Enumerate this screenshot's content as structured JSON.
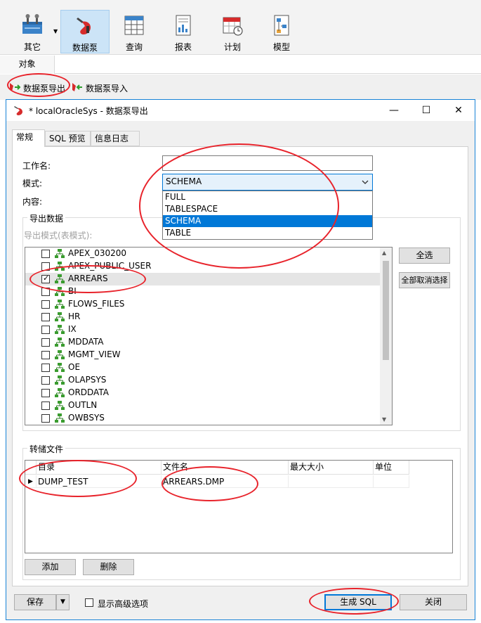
{
  "ribbon": {
    "items": [
      {
        "label": "其它"
      },
      {
        "label": "数据泵"
      },
      {
        "label": "查询"
      },
      {
        "label": "报表"
      },
      {
        "label": "计划"
      },
      {
        "label": "模型"
      }
    ]
  },
  "object_tab": {
    "label": "对象"
  },
  "toolbar2": {
    "export_label": "数据泵导出",
    "import_label": "数据泵导入"
  },
  "dialog": {
    "title": "* localOracleSys - 数据泵导出",
    "tabs": [
      {
        "label": "常规"
      },
      {
        "label": "SQL 预览"
      },
      {
        "label": "信息日志"
      }
    ],
    "job_name_label": "工作名:",
    "job_name_value": "",
    "mode_label": "模式:",
    "mode_value": "SCHEMA",
    "mode_options": [
      "FULL",
      "TABLESPACE",
      "SCHEMA",
      "TABLE"
    ],
    "content_label": "内容:",
    "export_group_title": "导出数据",
    "export_mode_label": "导出模式(表模式):",
    "schemas": [
      {
        "name": "APEX_030200",
        "checked": false
      },
      {
        "name": "APEX_PUBLIC_USER",
        "checked": false
      },
      {
        "name": "ARREARS",
        "checked": true
      },
      {
        "name": "BI",
        "checked": false
      },
      {
        "name": "FLOWS_FILES",
        "checked": false
      },
      {
        "name": "HR",
        "checked": false
      },
      {
        "name": "IX",
        "checked": false
      },
      {
        "name": "MDDATA",
        "checked": false
      },
      {
        "name": "MGMT_VIEW",
        "checked": false
      },
      {
        "name": "OE",
        "checked": false
      },
      {
        "name": "OLAPSYS",
        "checked": false
      },
      {
        "name": "ORDDATA",
        "checked": false
      },
      {
        "name": "OUTLN",
        "checked": false
      },
      {
        "name": "OWBSYS",
        "checked": false
      }
    ],
    "select_all_label": "全选",
    "deselect_all_label": "全部取消选择",
    "dump_group_title": "转储文件",
    "dump_columns": [
      "目录",
      "文件名",
      "最大大小",
      "单位"
    ],
    "dump_rows": [
      {
        "dir": "DUMP_TEST",
        "file": "ARREARS.DMP",
        "max": "",
        "unit": ""
      }
    ],
    "add_label": "添加",
    "delete_label": "删除",
    "save_label": "保存",
    "advanced_label": "显示高级选项",
    "generate_sql_label": "生成 SQL",
    "close_label": "关闭"
  }
}
